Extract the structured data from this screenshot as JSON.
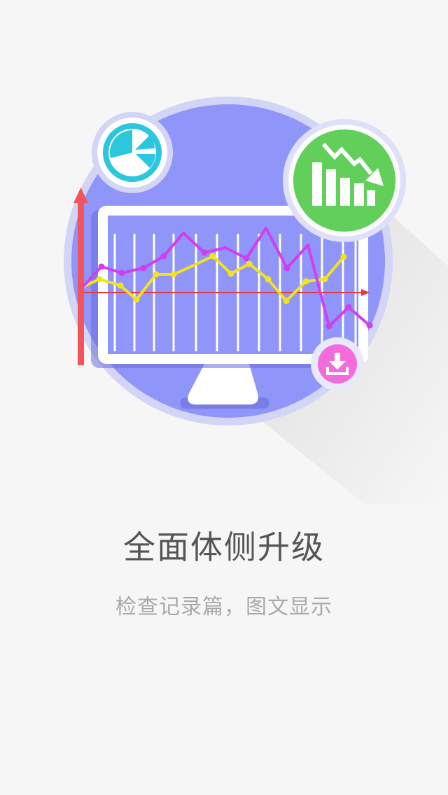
{
  "onboarding": {
    "title": "全面体侧升级",
    "subtitle": "检查记录篇，图文显示"
  },
  "illustration": {
    "icons": [
      "pie-chart-icon",
      "bar-chart-down-icon",
      "download-icon"
    ],
    "colors": {
      "background": "#f6f6f6",
      "circle": "#8f95f9",
      "circle_ring": "#d3d5f7",
      "pie_badge": "#2cc6dd",
      "trend_badge": "#62cf5a",
      "download_badge": "#f46cdc",
      "axis_arrow": "#f2545b",
      "series_magenta": "#cf3ff0",
      "series_yellow": "#f3e319",
      "baseline": "#e8383f"
    }
  }
}
